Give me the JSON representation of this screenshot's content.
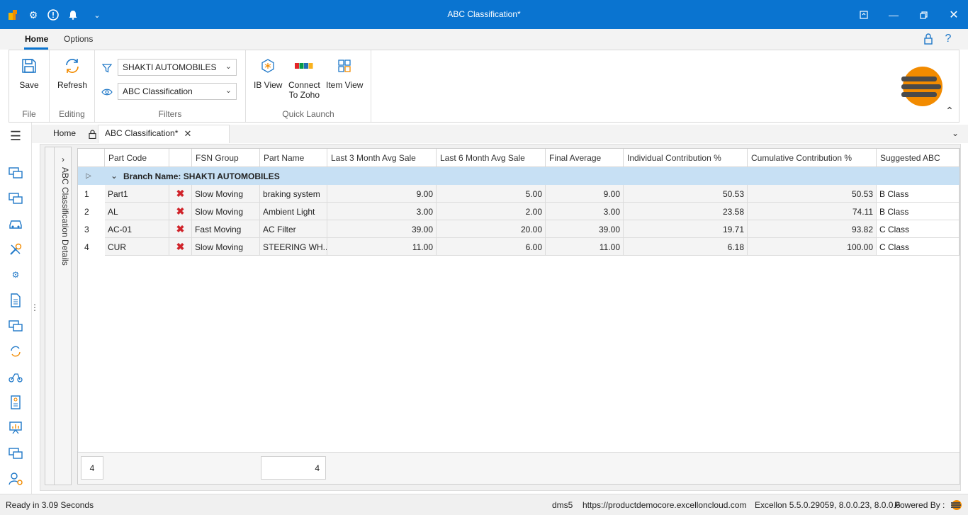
{
  "window": {
    "title": "ABC Classification*"
  },
  "ribbon_tabs": [
    "Home",
    "Options"
  ],
  "ribbon": {
    "file_group": {
      "label": "File",
      "save": "Save"
    },
    "editing_group": {
      "label": "Editing",
      "refresh": "Refresh"
    },
    "filters_group": {
      "label": "Filters",
      "company": "SHAKTI AUTOMOBILES",
      "view": "ABC Classification"
    },
    "quick_launch_group": {
      "label": "Quick Launch",
      "ib_view": "IB View",
      "connect_zoho_1": "Connect",
      "connect_zoho_2": "To Zoho",
      "item_view": "Item View"
    }
  },
  "doc_tabs": {
    "home": "Home",
    "active": "ABC Classification*"
  },
  "side_panel_label": "ABC Classification Details",
  "grid": {
    "columns": [
      "Part Code",
      "",
      "FSN Group",
      "Part Name",
      "Last 3 Month Avg Sale",
      "Last 6 Month Avg Sale",
      "Final Average",
      "Individual Contribution %",
      "Cumulative Contribution %",
      "Suggested ABC"
    ],
    "group_label": "Branch Name: SHAKTI AUTOMOBILES",
    "rows": [
      {
        "no": "1",
        "part_code": "Part1",
        "fsn": "Slow Moving",
        "part_name": "braking system",
        "l3": "9.00",
        "l6": "5.00",
        "final": "9.00",
        "ind": "50.53",
        "cum": "50.53",
        "abc": "B Class"
      },
      {
        "no": "2",
        "part_code": "AL",
        "fsn": "Slow Moving",
        "part_name": "Ambient Light",
        "l3": "3.00",
        "l6": "2.00",
        "final": "3.00",
        "ind": "23.58",
        "cum": "74.11",
        "abc": "B Class"
      },
      {
        "no": "3",
        "part_code": "AC-01",
        "fsn": "Fast Moving",
        "part_name": "AC Filter",
        "l3": "39.00",
        "l6": "20.00",
        "final": "39.00",
        "ind": "19.71",
        "cum": "93.82",
        "abc": "C Class"
      },
      {
        "no": "4",
        "part_code": "CUR",
        "fsn": "Slow Moving",
        "part_name": "STEERING WH...",
        "l3": "11.00",
        "l6": "6.00",
        "final": "11.00",
        "ind": "6.18",
        "cum": "100.00",
        "abc": "C Class"
      }
    ],
    "footer_count_left": "4",
    "footer_count_right": "4"
  },
  "status": {
    "ready": "Ready in 3.09 Seconds",
    "db": "dms5",
    "url": "https://productdemocore.excelloncloud.com",
    "version": "Excellon 5.5.0.29059, 8.0.0.23, 8.0.0.6",
    "powered": "Powered By :"
  },
  "colors": {
    "accent": "#0a74d0",
    "group_row": "#c7e0f4",
    "delete": "#d0232a"
  }
}
